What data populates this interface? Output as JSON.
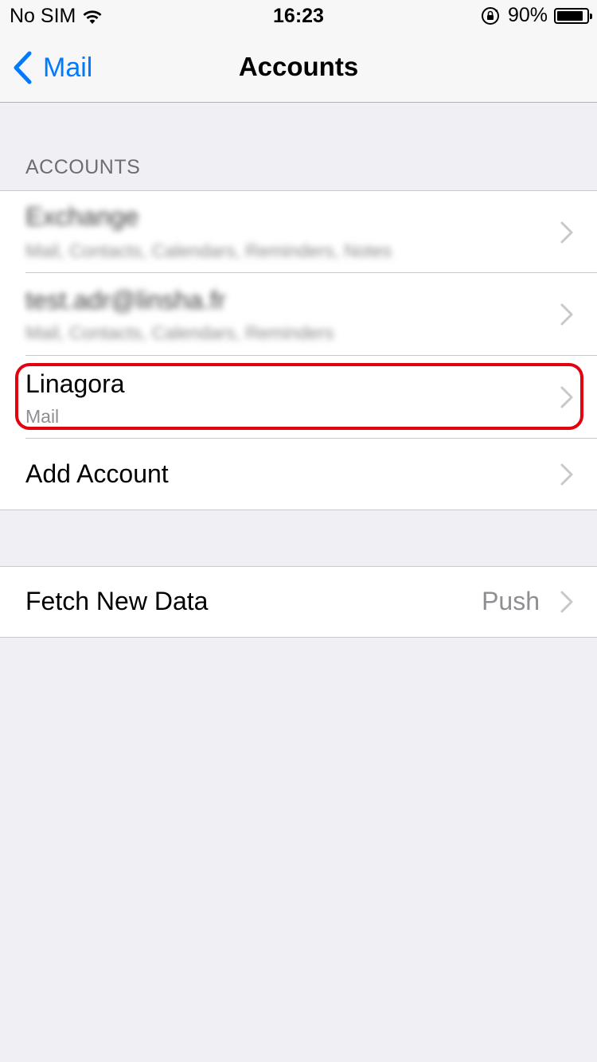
{
  "status_bar": {
    "carrier": "No SIM",
    "time": "16:23",
    "battery_percent": "90%",
    "battery_level": 0.9,
    "icons": [
      "wifi-icon",
      "rotation-lock-icon",
      "battery-icon"
    ]
  },
  "nav": {
    "back_label": "Mail",
    "title": "Accounts"
  },
  "accounts_section": {
    "header": "ACCOUNTS",
    "rows": [
      {
        "title": "Exchange",
        "subtitle": "Mail, Contacts, Calendars, Reminders, Notes",
        "blurred": true
      },
      {
        "title": "test.adr@linsha.fr",
        "subtitle": "Mail, Contacts, Calendars, Reminders",
        "blurred": true
      },
      {
        "title": "Linagora",
        "subtitle": "Mail",
        "highlighted": true
      },
      {
        "title": "Add Account"
      }
    ]
  },
  "fetch_section": {
    "label": "Fetch New Data",
    "value": "Push"
  },
  "colors": {
    "accent": "#007aff",
    "highlight": "#e3000f",
    "background": "#efeff4",
    "secondary_text": "#8e8e93",
    "chevron": "#c7c7cc"
  }
}
